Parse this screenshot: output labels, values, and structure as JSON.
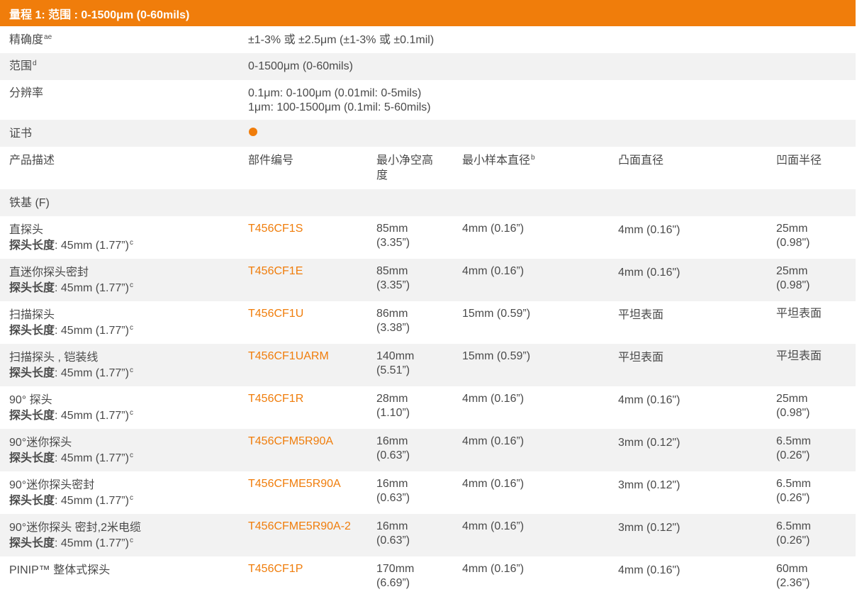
{
  "header": {
    "title": "量程 1: 范围 : 0-1500μm (0-60mils)"
  },
  "specs": {
    "accuracy_label": "精确度",
    "accuracy_sup": "ae",
    "accuracy_value": "±1-3% 或 ±2.5μm (±1-3% 或 ±0.1mil)",
    "range_label": "范围",
    "range_sup": "d",
    "range_value": "0-1500μm (0-60mils)",
    "resolution_label": "分辨率",
    "resolution_line1": "0.1μm: 0-100μm (0.01mil: 0-5mils)",
    "resolution_line2": "1μm: 100-1500μm (0.1mil: 5-60mils)",
    "certificate_label": "证书",
    "certificate_indicator_color": "#f07d0b"
  },
  "columns": {
    "description": "产品描述",
    "part_number": "部件编号",
    "clearance_line1": "最小净空高",
    "clearance_line2": "度",
    "sample_diameter": "最小样本直径",
    "sample_diameter_sup": "b",
    "convex_diameter": "凸面直径",
    "concave_radius": "凹面半径"
  },
  "section": {
    "label": "铁基 (F)"
  },
  "probe_length": {
    "label": "探头长度",
    "value": ": 45mm (1.77”)",
    "sup": "c"
  },
  "products": [
    {
      "name": "直探头",
      "part": "T456CF1S",
      "clearance1": "85mm",
      "clearance2": "(3.35”)",
      "sample": "4mm (0.16”)",
      "convex": "4mm (0.16\")",
      "concave1": "25mm",
      "concave2": "(0.98\")",
      "has_length": true
    },
    {
      "name": "直迷你探头密封",
      "part": "T456CF1E",
      "clearance1": "85mm",
      "clearance2": "(3.35”)",
      "sample": "4mm (0.16”)",
      "convex": "4mm (0.16\")",
      "concave1": "25mm",
      "concave2": "(0.98\")",
      "has_length": true
    },
    {
      "name": "扫描探头",
      "part": "T456CF1U",
      "clearance1": "86mm",
      "clearance2": "(3.38”)",
      "sample": "15mm (0.59”)",
      "convex": "平坦表面",
      "concave1": "平坦表面",
      "concave2": "",
      "has_length": true
    },
    {
      "name": "扫描探头 , 铠装线",
      "part": "T456CF1UARM",
      "clearance1": "140mm",
      "clearance2": "(5.51”)",
      "sample": "15mm (0.59”)",
      "convex": "平坦表面",
      "concave1": "平坦表面",
      "concave2": "",
      "has_length": true
    },
    {
      "name": "90° 探头",
      "part": "T456CF1R",
      "clearance1": "28mm",
      "clearance2": "(1.10”)",
      "sample": "4mm (0.16”)",
      "convex": "4mm (0.16\")",
      "concave1": "25mm",
      "concave2": "(0.98\")",
      "has_length": true
    },
    {
      "name": "90°迷你探头",
      "part": "T456CFM5R90A",
      "clearance1": "16mm",
      "clearance2": "(0.63”)",
      "sample": "4mm (0.16”)",
      "convex": "3mm (0.12\")",
      "concave1": "6.5mm",
      "concave2": "(0.26\")",
      "has_length": true
    },
    {
      "name": "90°迷你探头密封",
      "part": "T456CFME5R90A",
      "clearance1": "16mm",
      "clearance2": "(0.63”)",
      "sample": "4mm (0.16”)",
      "convex": "3mm (0.12\")",
      "concave1": "6.5mm",
      "concave2": "(0.26\")",
      "has_length": true
    },
    {
      "name": "90°迷你探头 密封,2米电缆",
      "part": "T456CFME5R90A-2",
      "clearance1": "16mm",
      "clearance2": "(0.63”)",
      "sample": "4mm (0.16”)",
      "convex": "3mm (0.12\")",
      "concave1": "6.5mm",
      "concave2": "(0.26\")",
      "has_length": true
    },
    {
      "name": "PINIP™ 整体式探头",
      "part": "T456CF1P",
      "clearance1": "170mm",
      "clearance2": "(6.69”)",
      "sample": "4mm (0.16”)",
      "convex": "4mm (0.16\")",
      "concave1": "60mm",
      "concave2": "(2.36\")",
      "has_length": false
    }
  ]
}
